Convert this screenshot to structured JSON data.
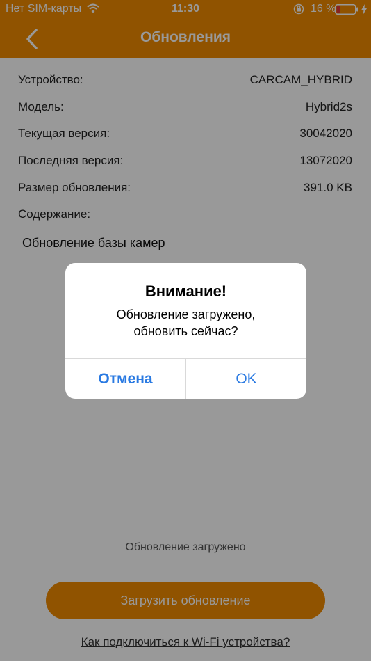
{
  "status_bar": {
    "carrier": "Нет SIM-карты",
    "time": "11:30",
    "battery_percent": "16 %"
  },
  "nav": {
    "title": "Обновления",
    "back_icon": "chevron-left-icon"
  },
  "info": {
    "rows": [
      {
        "label": "Устройство:",
        "value": "CARCAM_HYBRID"
      },
      {
        "label": "Модель:",
        "value": "Hybrid2s"
      },
      {
        "label": "Текущая версия:",
        "value": "30042020"
      },
      {
        "label": "Последняя версия:",
        "value": "13072020"
      },
      {
        "label": "Размер обновления:",
        "value": "391.0 KB"
      },
      {
        "label": "Содержание:",
        "value": ""
      }
    ],
    "content_text": "Обновление базы камер"
  },
  "main": {
    "status_text": "Обновление загружено",
    "download_label": "Загрузить обновление",
    "help_link": "Как подключиться к Wi-Fi устройства?"
  },
  "alert": {
    "title": "Внимание!",
    "message_line1": "Обновление загружено,",
    "message_line2": "обновить сейчас?",
    "cancel_label": "Отмена",
    "ok_label": "OK"
  },
  "colors": {
    "accent": "#f08a00",
    "link_blue": "#2a7ae2",
    "battery_low": "#e53935"
  }
}
